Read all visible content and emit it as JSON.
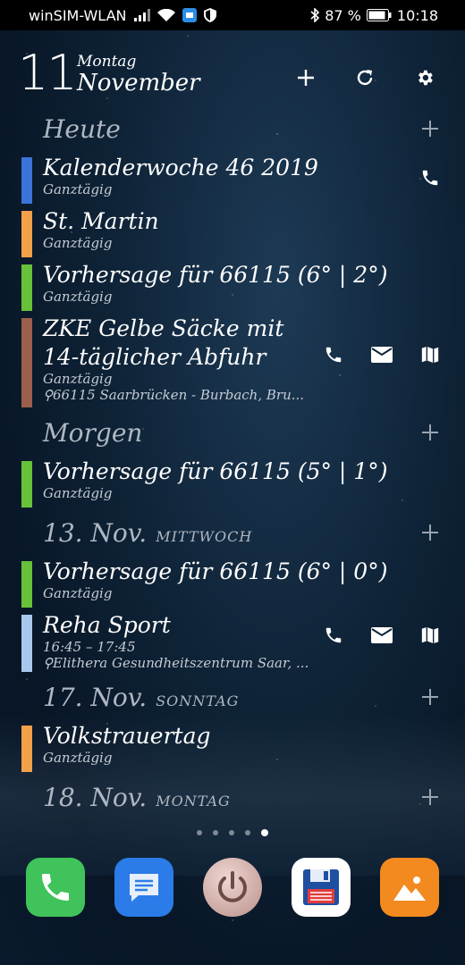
{
  "status_bar": {
    "carrier": "winSIM-WLAN",
    "battery": "87 %",
    "time": "10:18"
  },
  "header": {
    "day": "11",
    "weekday": "Montag",
    "month": "November"
  },
  "sections": [
    {
      "title": "Heute",
      "subtitle": ""
    },
    {
      "title": "Morgen",
      "subtitle": ""
    },
    {
      "title": "13. Nov.",
      "subtitle": "MITTWOCH"
    },
    {
      "title": "17. Nov.",
      "subtitle": "SONNTAG"
    },
    {
      "title": "18. Nov.",
      "subtitle": "MONTAG"
    }
  ],
  "events": [
    {
      "title": "Kalenderwoche 46 2019",
      "sub": "Ganztägig",
      "color": "#3a74d8"
    },
    {
      "title": "St. Martin",
      "sub": "Ganztägig",
      "color": "#f2a04a"
    },
    {
      "title": "Vorhersage für 66115 (6° | 2°)",
      "sub": "Ganztägig",
      "color": "#67c23a"
    },
    {
      "title_line1": "ZKE Gelbe Säcke mit",
      "title_line2": "14-täglicher Abfuhr",
      "sub": "Ganztägig",
      "location": "66115 Saarbrücken - Burbach, Bru...",
      "color": "#9b5f4c"
    },
    {
      "title": "Vorhersage für 66115 (5° | 1°)",
      "sub": "Ganztägig",
      "color": "#67c23a"
    },
    {
      "title": "Vorhersage für 66115 (6° | 0°)",
      "sub": "Ganztägig",
      "color": "#67c23a"
    },
    {
      "title": "Reha Sport",
      "sub": "16:45 – 17:45",
      "location": "Elithera Gesundheitszentrum Saar, ...",
      "color": "#a9c8ef"
    },
    {
      "title": "Volkstrauertag",
      "sub": "Ganztägig",
      "color": "#f2a04a"
    }
  ],
  "page_indicator": {
    "count": 5,
    "active": 5
  },
  "icons": {
    "add": "plus-icon",
    "refresh": "refresh-icon",
    "settings": "gear-icon",
    "phone": "phone-icon",
    "mail": "mail-icon",
    "map": "map-icon"
  },
  "colors": {
    "phone_app": "#3fc35a",
    "messages_app": "#2b7ce9",
    "calendar_app": "#d8b9b4",
    "save_app": "#ffffff",
    "gallery_app": "#f28a20"
  }
}
